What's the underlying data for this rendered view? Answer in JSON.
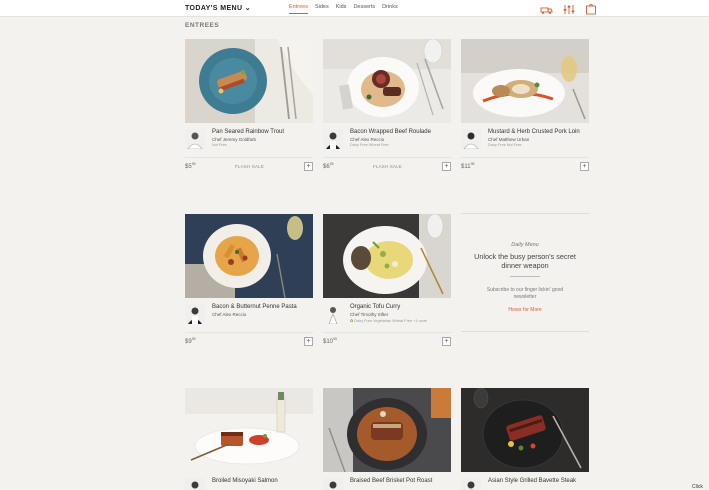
{
  "header": {
    "brand": "TODAY'S MENU",
    "nav": [
      "Entrees",
      "Sides",
      "Kids",
      "Desserts",
      "Drinks"
    ]
  },
  "section_title": "ENTREES",
  "cards": [
    {
      "title": "Pan Seared Rainbow Trout",
      "chef": "Chef Jeremy Goldfarb",
      "tags": "Nut Free",
      "price": "$5",
      "cents": "95",
      "flash": "FLASH SALE"
    },
    {
      "title": "Bacon Wrapped Beef Roulade",
      "chef": "Chef Alex Reccio",
      "tags": "Dairy Free   Wheat Free",
      "price": "$6",
      "cents": "95",
      "flash": "FLASH SALE"
    },
    {
      "title": "Mustard & Herb Crusted Pork Loin",
      "chef": "Chef Matthew Urban",
      "tags": "Dairy Free   Nut Free",
      "price": "$11",
      "cents": "95",
      "flash": ""
    },
    {
      "title": "Bacon & Butternut Penne Pasta",
      "chef": "Chef Alex Reccio",
      "tags": "",
      "price": "$9",
      "cents": "95",
      "flash": ""
    },
    {
      "title": "Organic Tofu Curry",
      "chef": "Chef Timothy Sifter",
      "tags": "Dairy Free   Vegetarian   Wheat Free   +1 more",
      "price": "$10",
      "cents": "95",
      "flash": ""
    },
    {
      "title": "Broiled Misoyaki Salmon",
      "chef": "",
      "tags": "",
      "price": "",
      "cents": "",
      "flash": ""
    },
    {
      "title": "Braised Beef Brisket Pot Roast",
      "chef": "",
      "tags": "",
      "price": "",
      "cents": "",
      "flash": ""
    },
    {
      "title": "Asian Style Grilled Bavette Steak",
      "chef": "",
      "tags": "",
      "price": "",
      "cents": "",
      "flash": ""
    }
  ],
  "newsletter": {
    "subtitle": "Daily Menu",
    "title": "Unlock the busy person's secret dinner weapon",
    "description": "Subscribe to our finger lickin' good newsletter",
    "link": "Hover for More"
  },
  "corner_text": "Click",
  "colors": {
    "accent": "#e05a2b"
  }
}
